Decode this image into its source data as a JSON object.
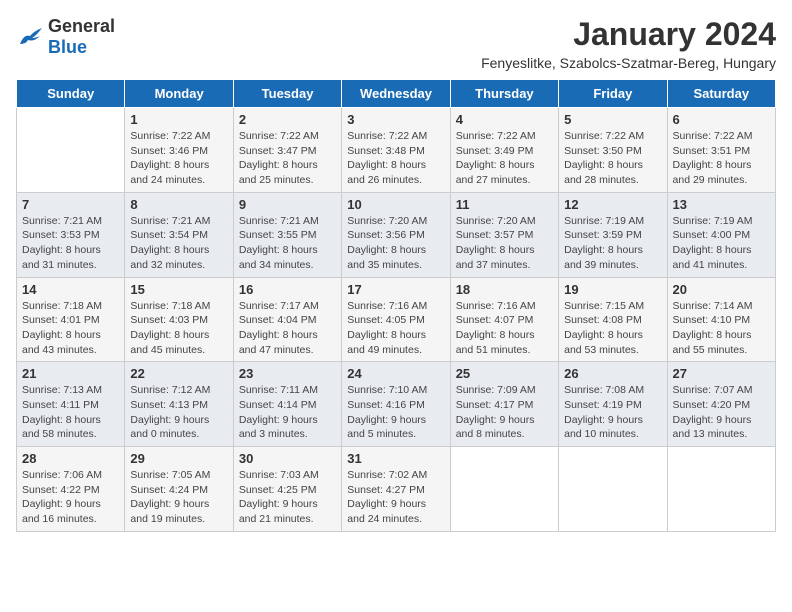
{
  "header": {
    "logo_general": "General",
    "logo_blue": "Blue",
    "title": "January 2024",
    "subtitle": "Fenyeslitke, Szabolcs-Szatmar-Bereg, Hungary"
  },
  "days_of_week": [
    "Sunday",
    "Monday",
    "Tuesday",
    "Wednesday",
    "Thursday",
    "Friday",
    "Saturday"
  ],
  "weeks": [
    [
      {
        "day": "",
        "info": ""
      },
      {
        "day": "1",
        "info": "Sunrise: 7:22 AM\nSunset: 3:46 PM\nDaylight: 8 hours\nand 24 minutes."
      },
      {
        "day": "2",
        "info": "Sunrise: 7:22 AM\nSunset: 3:47 PM\nDaylight: 8 hours\nand 25 minutes."
      },
      {
        "day": "3",
        "info": "Sunrise: 7:22 AM\nSunset: 3:48 PM\nDaylight: 8 hours\nand 26 minutes."
      },
      {
        "day": "4",
        "info": "Sunrise: 7:22 AM\nSunset: 3:49 PM\nDaylight: 8 hours\nand 27 minutes."
      },
      {
        "day": "5",
        "info": "Sunrise: 7:22 AM\nSunset: 3:50 PM\nDaylight: 8 hours\nand 28 minutes."
      },
      {
        "day": "6",
        "info": "Sunrise: 7:22 AM\nSunset: 3:51 PM\nDaylight: 8 hours\nand 29 minutes."
      }
    ],
    [
      {
        "day": "7",
        "info": "Sunrise: 7:21 AM\nSunset: 3:53 PM\nDaylight: 8 hours\nand 31 minutes."
      },
      {
        "day": "8",
        "info": "Sunrise: 7:21 AM\nSunset: 3:54 PM\nDaylight: 8 hours\nand 32 minutes."
      },
      {
        "day": "9",
        "info": "Sunrise: 7:21 AM\nSunset: 3:55 PM\nDaylight: 8 hours\nand 34 minutes."
      },
      {
        "day": "10",
        "info": "Sunrise: 7:20 AM\nSunset: 3:56 PM\nDaylight: 8 hours\nand 35 minutes."
      },
      {
        "day": "11",
        "info": "Sunrise: 7:20 AM\nSunset: 3:57 PM\nDaylight: 8 hours\nand 37 minutes."
      },
      {
        "day": "12",
        "info": "Sunrise: 7:19 AM\nSunset: 3:59 PM\nDaylight: 8 hours\nand 39 minutes."
      },
      {
        "day": "13",
        "info": "Sunrise: 7:19 AM\nSunset: 4:00 PM\nDaylight: 8 hours\nand 41 minutes."
      }
    ],
    [
      {
        "day": "14",
        "info": "Sunrise: 7:18 AM\nSunset: 4:01 PM\nDaylight: 8 hours\nand 43 minutes."
      },
      {
        "day": "15",
        "info": "Sunrise: 7:18 AM\nSunset: 4:03 PM\nDaylight: 8 hours\nand 45 minutes."
      },
      {
        "day": "16",
        "info": "Sunrise: 7:17 AM\nSunset: 4:04 PM\nDaylight: 8 hours\nand 47 minutes."
      },
      {
        "day": "17",
        "info": "Sunrise: 7:16 AM\nSunset: 4:05 PM\nDaylight: 8 hours\nand 49 minutes."
      },
      {
        "day": "18",
        "info": "Sunrise: 7:16 AM\nSunset: 4:07 PM\nDaylight: 8 hours\nand 51 minutes."
      },
      {
        "day": "19",
        "info": "Sunrise: 7:15 AM\nSunset: 4:08 PM\nDaylight: 8 hours\nand 53 minutes."
      },
      {
        "day": "20",
        "info": "Sunrise: 7:14 AM\nSunset: 4:10 PM\nDaylight: 8 hours\nand 55 minutes."
      }
    ],
    [
      {
        "day": "21",
        "info": "Sunrise: 7:13 AM\nSunset: 4:11 PM\nDaylight: 8 hours\nand 58 minutes."
      },
      {
        "day": "22",
        "info": "Sunrise: 7:12 AM\nSunset: 4:13 PM\nDaylight: 9 hours\nand 0 minutes."
      },
      {
        "day": "23",
        "info": "Sunrise: 7:11 AM\nSunset: 4:14 PM\nDaylight: 9 hours\nand 3 minutes."
      },
      {
        "day": "24",
        "info": "Sunrise: 7:10 AM\nSunset: 4:16 PM\nDaylight: 9 hours\nand 5 minutes."
      },
      {
        "day": "25",
        "info": "Sunrise: 7:09 AM\nSunset: 4:17 PM\nDaylight: 9 hours\nand 8 minutes."
      },
      {
        "day": "26",
        "info": "Sunrise: 7:08 AM\nSunset: 4:19 PM\nDaylight: 9 hours\nand 10 minutes."
      },
      {
        "day": "27",
        "info": "Sunrise: 7:07 AM\nSunset: 4:20 PM\nDaylight: 9 hours\nand 13 minutes."
      }
    ],
    [
      {
        "day": "28",
        "info": "Sunrise: 7:06 AM\nSunset: 4:22 PM\nDaylight: 9 hours\nand 16 minutes."
      },
      {
        "day": "29",
        "info": "Sunrise: 7:05 AM\nSunset: 4:24 PM\nDaylight: 9 hours\nand 19 minutes."
      },
      {
        "day": "30",
        "info": "Sunrise: 7:03 AM\nSunset: 4:25 PM\nDaylight: 9 hours\nand 21 minutes."
      },
      {
        "day": "31",
        "info": "Sunrise: 7:02 AM\nSunset: 4:27 PM\nDaylight: 9 hours\nand 24 minutes."
      },
      {
        "day": "",
        "info": ""
      },
      {
        "day": "",
        "info": ""
      },
      {
        "day": "",
        "info": ""
      }
    ]
  ]
}
